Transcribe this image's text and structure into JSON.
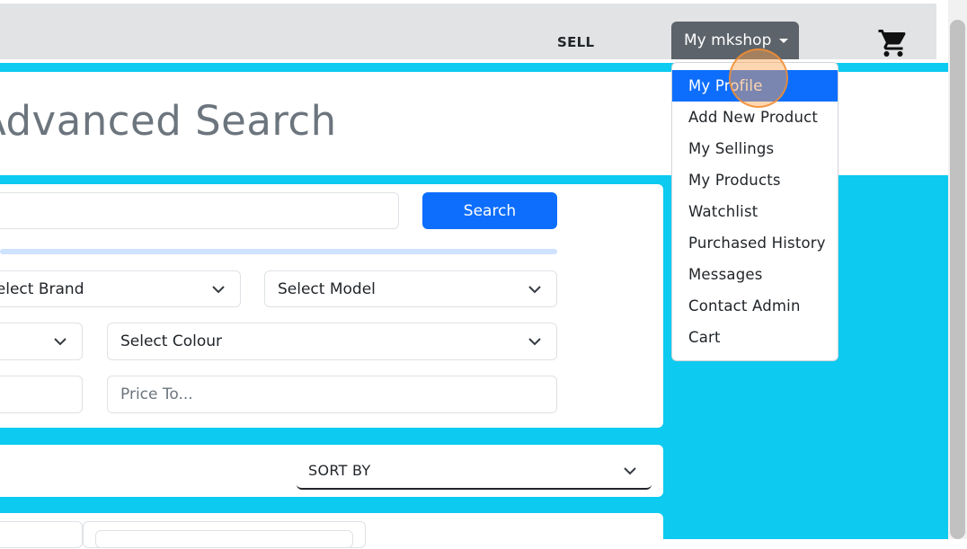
{
  "navbar": {
    "sell_label": "SELL",
    "account_label": "My mkshop",
    "cart_icon": "cart-icon"
  },
  "page": {
    "title": "Advanced Search"
  },
  "search": {
    "input_value": "",
    "button_label": "Search"
  },
  "filters": {
    "brand_label": "Select Brand",
    "model_label": "Select Model",
    "colour_label": "Select Colour",
    "price_to_placeholder": "Price To..."
  },
  "sort": {
    "label": "SORT BY"
  },
  "dropdown": {
    "items": [
      {
        "label": "My Profile"
      },
      {
        "label": "Add New Product"
      },
      {
        "label": "My Sellings"
      },
      {
        "label": "My Products"
      },
      {
        "label": "Watchlist"
      },
      {
        "label": "Purchased History"
      },
      {
        "label": "Messages"
      },
      {
        "label": "Contact Admin"
      },
      {
        "label": "Cart"
      }
    ]
  },
  "colors": {
    "accent": "#0dcaf0",
    "primary": "#0d6efd",
    "navbar": "#e2e3e5",
    "account_button": "#5c636a"
  }
}
